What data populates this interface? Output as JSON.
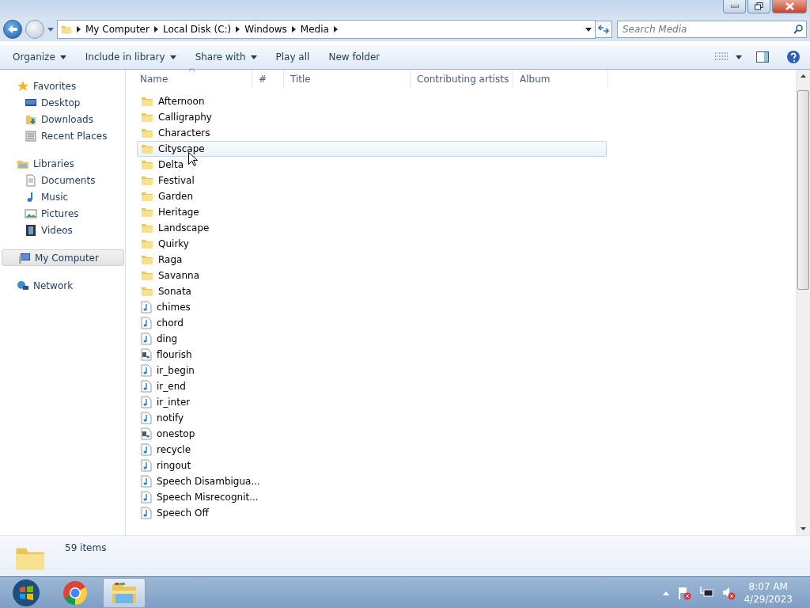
{
  "address": {
    "crumbs": [
      "My Computer",
      "Local Disk (C:)",
      "Windows",
      "Media"
    ]
  },
  "search": {
    "placeholder": "Search Media"
  },
  "toolbar": {
    "buttons": [
      {
        "label": "Organize",
        "dropdown": true
      },
      {
        "label": "Include in library",
        "dropdown": true
      },
      {
        "label": "Share with",
        "dropdown": true
      },
      {
        "label": "Play all",
        "dropdown": false
      },
      {
        "label": "New folder",
        "dropdown": false
      }
    ]
  },
  "sidebar": {
    "groups": [
      {
        "label": "Favorites",
        "kind": "star",
        "selected": false,
        "children": [
          {
            "label": "Desktop",
            "kind": "desktop",
            "selected": false
          },
          {
            "label": "Downloads",
            "kind": "downloads",
            "selected": false
          },
          {
            "label": "Recent Places",
            "kind": "recent",
            "selected": false
          }
        ]
      },
      {
        "label": "Libraries",
        "kind": "library",
        "selected": false,
        "children": [
          {
            "label": "Documents",
            "kind": "document",
            "selected": false
          },
          {
            "label": "Music",
            "kind": "music",
            "selected": false
          },
          {
            "label": "Pictures",
            "kind": "pictures",
            "selected": false
          },
          {
            "label": "Videos",
            "kind": "videos",
            "selected": false
          }
        ]
      },
      {
        "label": "My Computer",
        "kind": "computer",
        "selected": true
      },
      {
        "label": "Network",
        "kind": "network",
        "selected": false
      }
    ]
  },
  "table": {
    "columns": [
      "Name",
      "#",
      "Title",
      "Contributing artists",
      "Album"
    ],
    "rows": [
      {
        "name": "Afternoon",
        "kind": "folder",
        "selected": false
      },
      {
        "name": "Calligraphy",
        "kind": "folder",
        "selected": false
      },
      {
        "name": "Characters",
        "kind": "folder",
        "selected": false
      },
      {
        "name": "Cityscape",
        "kind": "folder",
        "selected": true
      },
      {
        "name": "Delta",
        "kind": "folder",
        "selected": false
      },
      {
        "name": "Festival",
        "kind": "folder",
        "selected": false
      },
      {
        "name": "Garden",
        "kind": "folder",
        "selected": false
      },
      {
        "name": "Heritage",
        "kind": "folder",
        "selected": false
      },
      {
        "name": "Landscape",
        "kind": "folder",
        "selected": false
      },
      {
        "name": "Quirky",
        "kind": "folder",
        "selected": false
      },
      {
        "name": "Raga",
        "kind": "folder",
        "selected": false
      },
      {
        "name": "Savanna",
        "kind": "folder",
        "selected": false
      },
      {
        "name": "Sonata",
        "kind": "folder",
        "selected": false
      },
      {
        "name": "chimes",
        "kind": "audio",
        "selected": false
      },
      {
        "name": "chord",
        "kind": "audio",
        "selected": false
      },
      {
        "name": "ding",
        "kind": "audio",
        "selected": false
      },
      {
        "name": "flourish",
        "kind": "midi",
        "selected": false
      },
      {
        "name": "ir_begin",
        "kind": "audio",
        "selected": false
      },
      {
        "name": "ir_end",
        "kind": "audio",
        "selected": false
      },
      {
        "name": "ir_inter",
        "kind": "audio",
        "selected": false
      },
      {
        "name": "notify",
        "kind": "audio",
        "selected": false
      },
      {
        "name": "onestop",
        "kind": "midi",
        "selected": false
      },
      {
        "name": "recycle",
        "kind": "audio",
        "selected": false
      },
      {
        "name": "ringout",
        "kind": "audio",
        "selected": false
      },
      {
        "name": "Speech Disambigua...",
        "kind": "audio",
        "selected": false
      },
      {
        "name": "Speech Misrecognit...",
        "kind": "audio",
        "selected": false
      },
      {
        "name": "Speech Off",
        "kind": "audio",
        "selected": false
      }
    ]
  },
  "details": {
    "count": "59 items"
  },
  "clock": {
    "time": "8:07 AM",
    "date": "4/29/2023"
  }
}
